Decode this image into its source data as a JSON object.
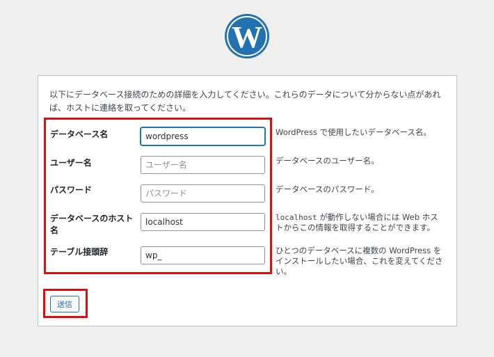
{
  "logo": {
    "icon": "wordpress-logo-icon",
    "color": "#2271b1"
  },
  "intro": "以下にデータベース接続のための詳細を入力してください。これらのデータについて分からない点があれば、ホストに連絡を取ってください。",
  "fields": [
    {
      "label": "データベース名",
      "value": "wordpress",
      "placeholder": "",
      "desc": "WordPress で使用したいデータベース名。"
    },
    {
      "label": "ユーザー名",
      "value": "",
      "placeholder": "ユーザー名",
      "desc": "データベースのユーザー名。"
    },
    {
      "label": "パスワード",
      "value": "",
      "placeholder": "パスワード",
      "desc": "データベースのパスワード。"
    },
    {
      "label": "データベースのホスト名",
      "value": "localhost",
      "placeholder": "",
      "desc_code": "localhost",
      "desc_rest": " が動作しない場合には Web ホストからこの情報を取得することができます。"
    },
    {
      "label": "テーブル接頭辞",
      "value": "wp_",
      "placeholder": "",
      "desc": "ひとつのデータベースに複数の WordPress をインストールしたい場合、これを変えてください。"
    }
  ],
  "submit_label": "送信",
  "colors": {
    "accent": "#2271b1",
    "highlight": "#e00d0d",
    "background": "#f0f0f1"
  }
}
